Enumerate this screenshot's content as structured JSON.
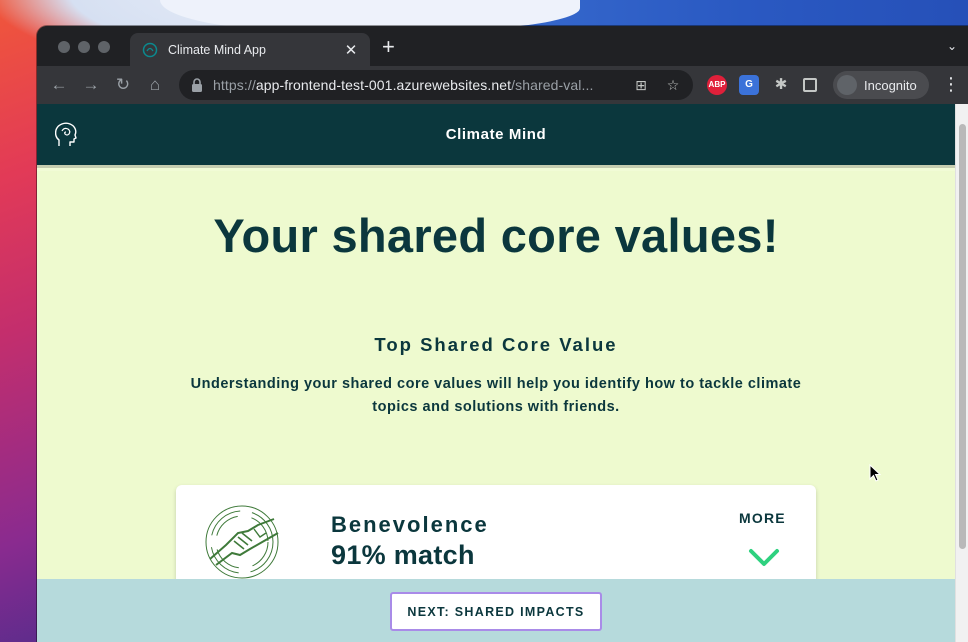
{
  "browser": {
    "tab_title": "Climate Mind App",
    "tab_close_glyph": "✕",
    "new_tab_glyph": "+",
    "url_scheme": "https://",
    "url_host": "app-frontend-test-001.azurewebsites.net",
    "url_path": "/shared-val...",
    "incognito_label": "Incognito",
    "extensions": [
      "ABP",
      "G"
    ]
  },
  "app": {
    "title": "Climate Mind",
    "page_title": "Your shared core values!",
    "section_title": "Top Shared Core Value",
    "section_text": "Understanding your shared core values will help you identify how to tackle climate topics and solutions with friends.",
    "value_card": {
      "name": "Benevolence",
      "match": "91% match",
      "more_label": "MORE",
      "icon": "handshake-icon"
    },
    "next_button": "NEXT: SHARED IMPACTS"
  },
  "colors": {
    "header_bg": "#0b373d",
    "page_bg": "#eefacf",
    "footer_bg": "#b6dadc",
    "accent_green": "#2ed17f",
    "button_border": "#a98be8"
  }
}
